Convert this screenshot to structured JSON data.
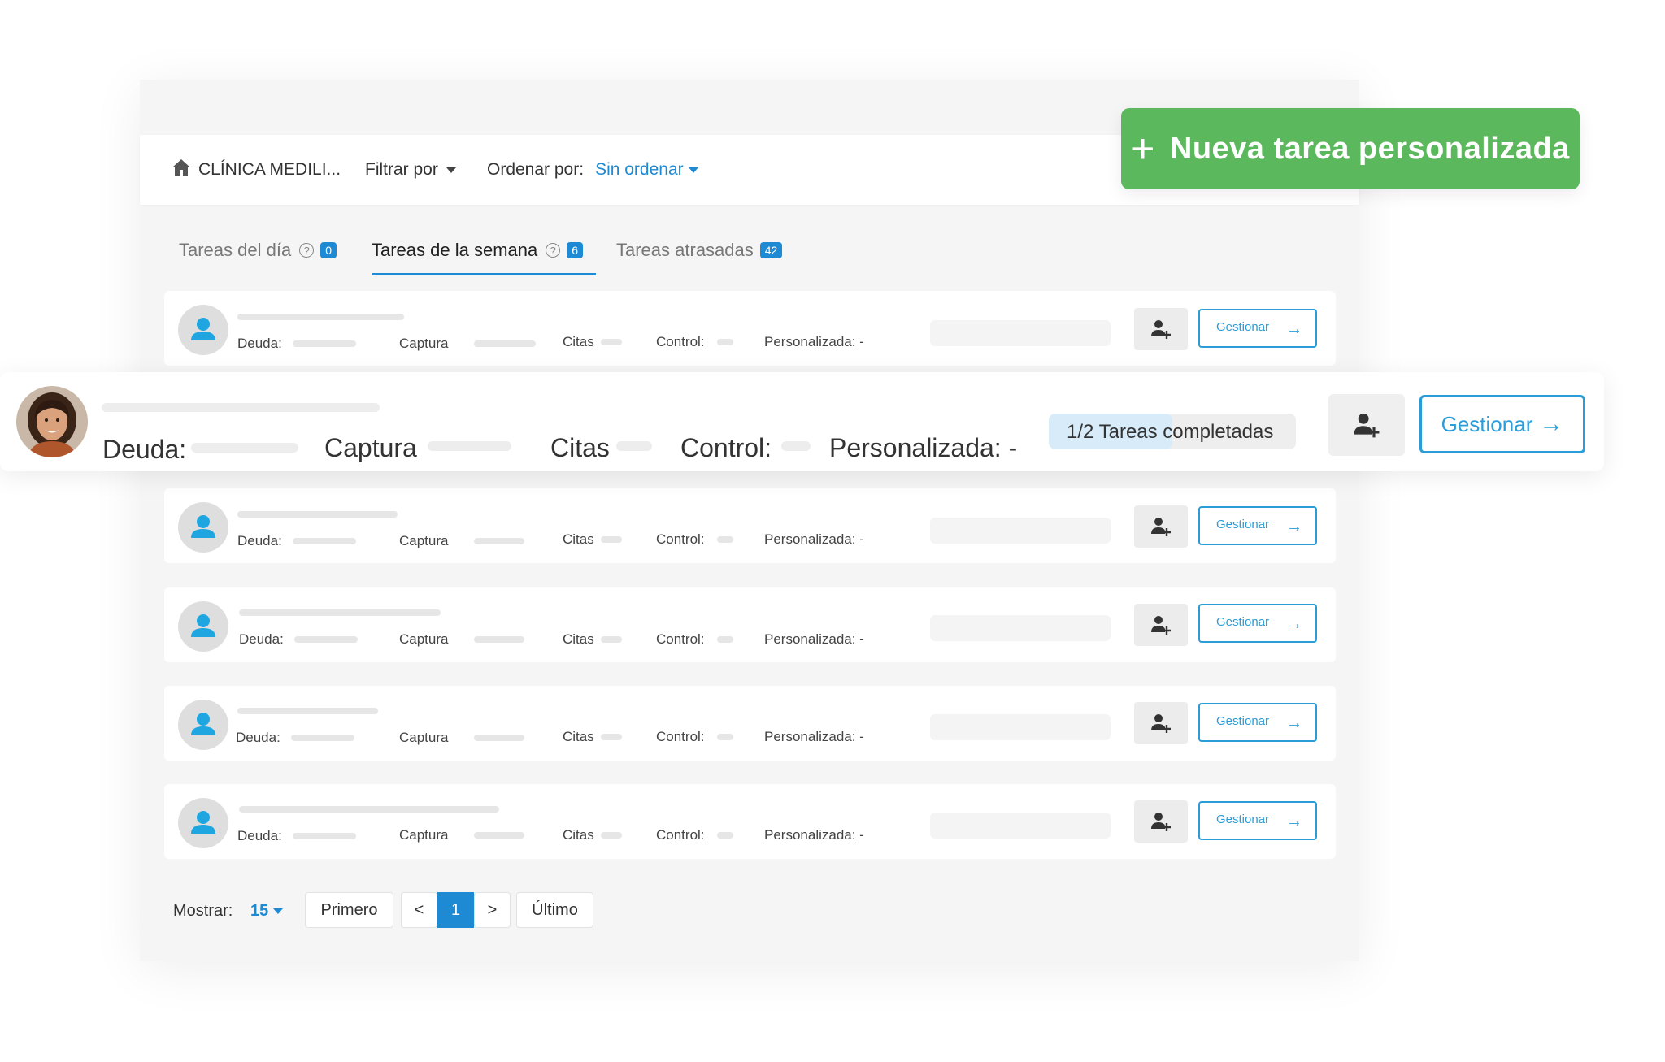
{
  "header": {
    "clinic": "CLÍNICA MEDILI...",
    "filter_label": "Filtrar por",
    "order_label": "Ordenar por:",
    "order_value": "Sin ordenar"
  },
  "new_task_button": {
    "label": "Nueva tarea personalizada",
    "color": "#5cb85c"
  },
  "tabs": [
    {
      "label": "Tareas del día",
      "badge": "0",
      "has_help": true
    },
    {
      "label": "Tareas de la semana",
      "badge": "6",
      "has_help": true,
      "active": true
    },
    {
      "label": "Tareas atrasadas",
      "badge": "42",
      "has_help": false
    }
  ],
  "row_labels": {
    "deuda": "Deuda:",
    "captura": "Captura",
    "citas": "Citas",
    "control": "Control:",
    "personalizada": "Personalizada: -",
    "manage": "Gestionar"
  },
  "featured_row": {
    "deuda": "Deuda:",
    "captura": "Captura",
    "citas": "Citas",
    "control": "Control:",
    "personalizada": "Personalizada: -",
    "progress_text": "1/2 Tareas completadas",
    "progress_fraction": 0.5,
    "manage": "Gestionar"
  },
  "pagination": {
    "show_label": "Mostrar:",
    "show_value": "15",
    "first": "Primero",
    "prev": "<",
    "current": "1",
    "next": ">",
    "last": "Último"
  },
  "colors": {
    "accent": "#1e8ad3",
    "manage_border": "#2a9dd8",
    "green": "#5cb85c"
  }
}
